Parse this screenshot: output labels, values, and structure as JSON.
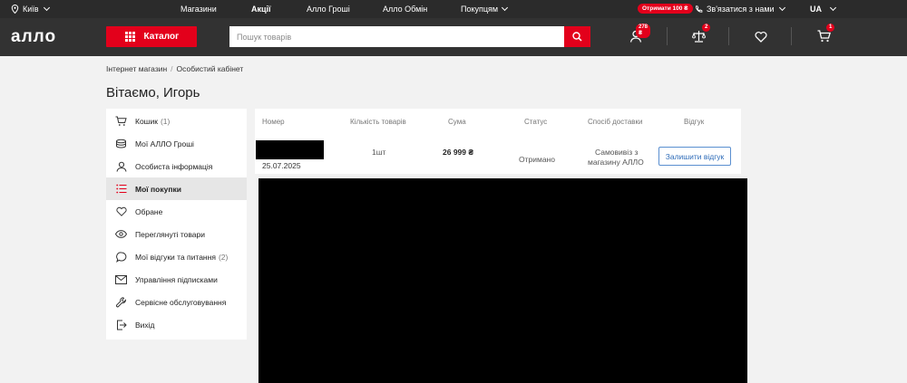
{
  "topbar": {
    "city": "Київ",
    "nav": [
      "Магазини",
      "Акції",
      "Алло Гроші",
      "Алло Обмін",
      "Покупцям"
    ],
    "promo": "Отримати 100 ₴",
    "contact": "Зв'язатися з нами",
    "lang": "UA"
  },
  "header": {
    "logo": "алло",
    "catalog_label": "Каталог",
    "search_placeholder": "Пошук товарів",
    "badges": {
      "profile": "278 ₴",
      "compare": "2",
      "cart": "1"
    }
  },
  "breadcrumb": [
    "Інтернет магазин",
    "Особистий кабінет"
  ],
  "page_title": "Вітаємо, Игорь",
  "sidebar": {
    "items": [
      {
        "label": "Кошик",
        "count": "(1)"
      },
      {
        "label": "Мої АЛЛО Гроші",
        "count": ""
      },
      {
        "label": "Особиста інформація",
        "count": ""
      },
      {
        "label": "Мої покупки",
        "count": ""
      },
      {
        "label": "Обране",
        "count": ""
      },
      {
        "label": "Переглянуті товари",
        "count": ""
      },
      {
        "label": "Мої відгуки та питання",
        "count": "(2)"
      },
      {
        "label": "Управління підписками",
        "count": ""
      },
      {
        "label": "Сервісне обслуговування",
        "count": ""
      },
      {
        "label": "Вихід",
        "count": ""
      }
    ],
    "active_index": 3
  },
  "orders": {
    "columns": [
      "Номер",
      "Кількість товарів",
      "Сума",
      "Статус",
      "Спосіб доставки",
      "Відгук"
    ],
    "rows": [
      {
        "date": "25.07.2025",
        "quantity": "1шт",
        "sum": "26 999 ₴",
        "status": "Отримано",
        "delivery_line1": "Самовивіз з",
        "delivery_line2": "магазину АЛЛО",
        "review_button": "Залишити відгук"
      }
    ]
  },
  "colors": {
    "accent": "#e3001b",
    "header_bg": "#323232",
    "topbar_bg": "#2b2b2b",
    "link": "#2d6bb8"
  }
}
